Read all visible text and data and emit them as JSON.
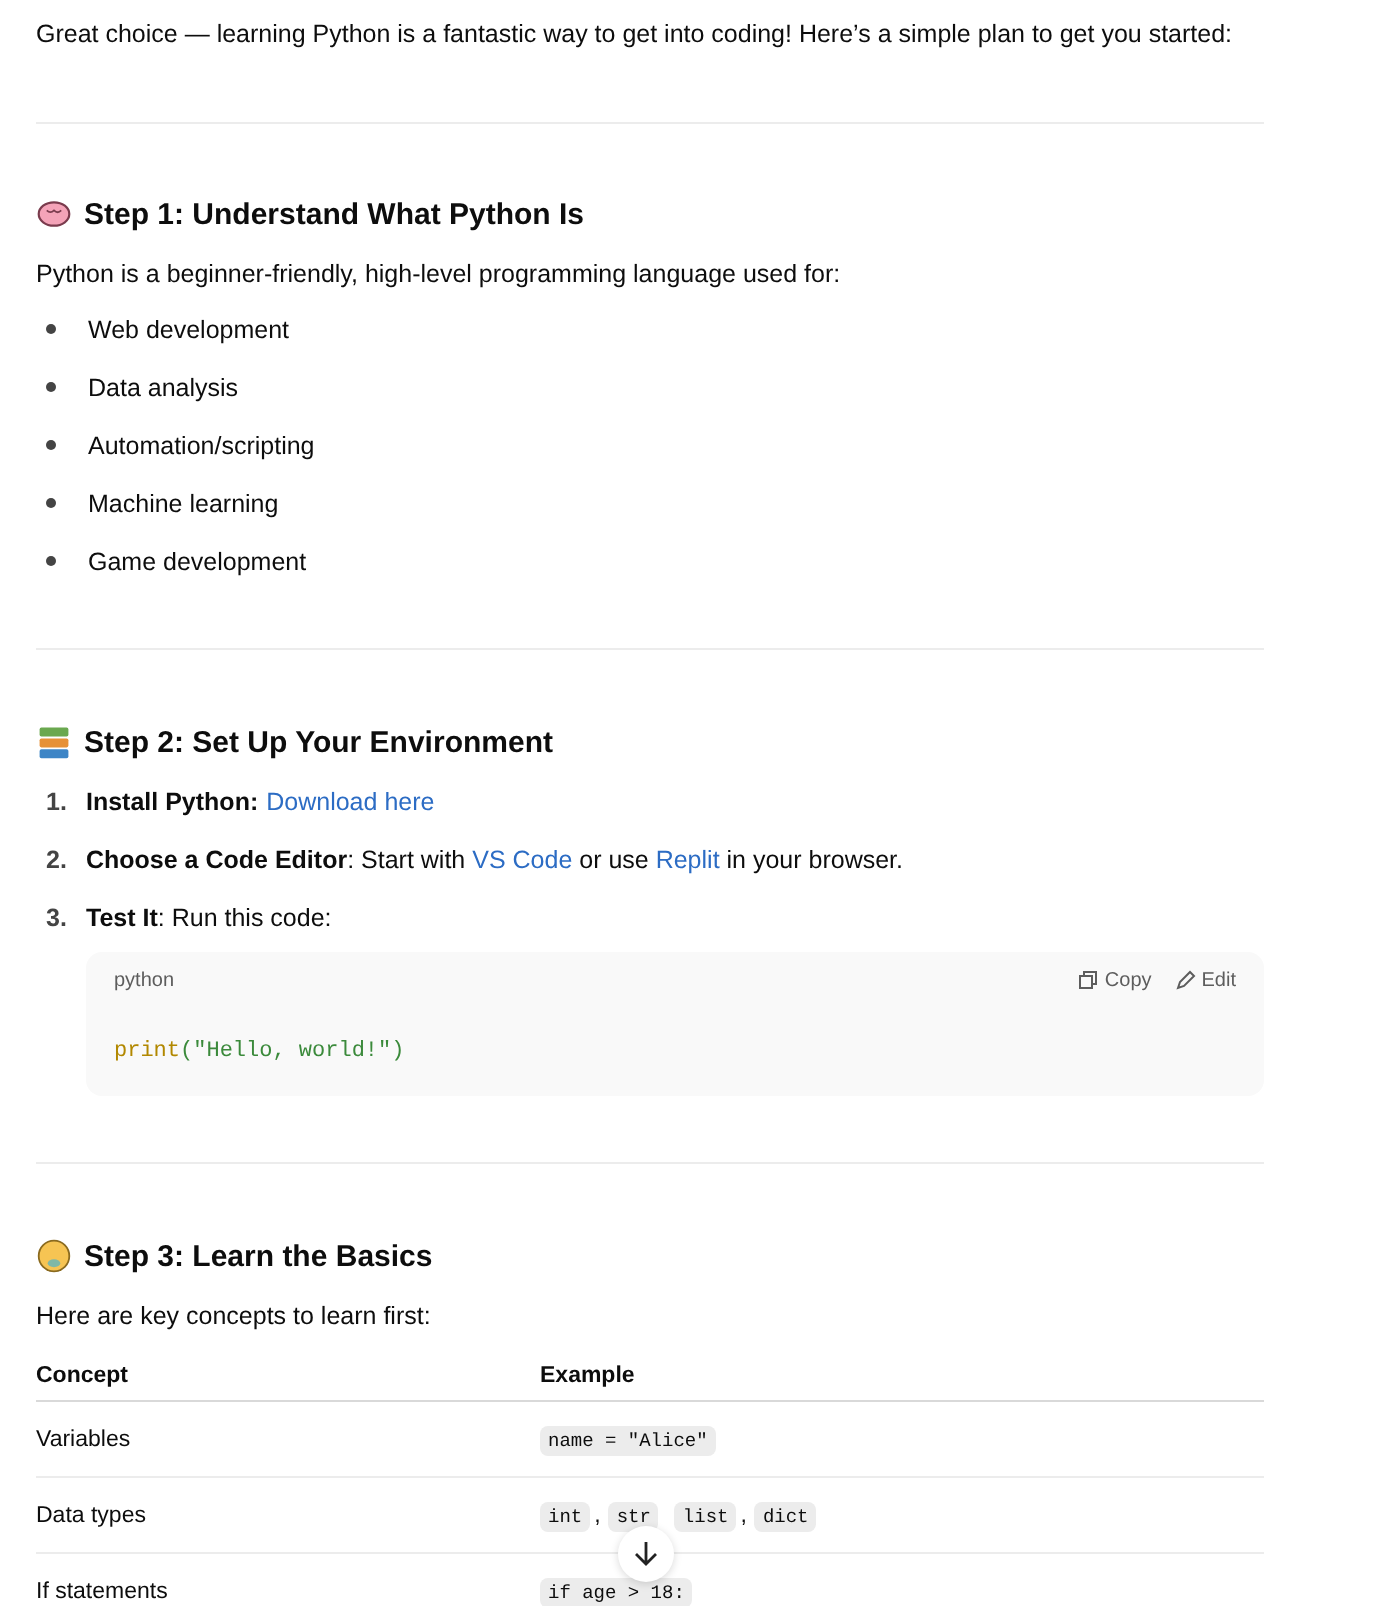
{
  "intro": "Great choice — learning Python is a fantastic way to get into coding! Here’s a simple plan to get you started:",
  "sections": [
    {
      "title": "Step 1: Understand What Python Is",
      "paragraph": "Python is a beginner-friendly, high-level programming language used for:",
      "bullets": [
        "Web development",
        "Data analysis",
        "Automation/scripting",
        "Machine learning",
        "Game development"
      ]
    },
    {
      "title": "Step 2: Set Up Your Environment",
      "steps": [
        {
          "number": "1.",
          "parts": [
            {
              "kind": "bold",
              "text": "Install Python:"
            },
            {
              "kind": "link",
              "text": "Download here"
            }
          ]
        },
        {
          "number": "2.",
          "parts": [
            {
              "kind": "bold",
              "text": "Choose a Code Editor"
            },
            {
              "kind": "plain",
              "text": ": Start with "
            },
            {
              "kind": "link",
              "text": "VS Code"
            },
            {
              "kind": "plain",
              "text": " or use "
            },
            {
              "kind": "link",
              "text": "Replit"
            },
            {
              "kind": "plain",
              "text": " in your browser."
            }
          ]
        },
        {
          "number": "3.",
          "parts": [
            {
              "kind": "bold",
              "text": "Test It"
            },
            {
              "kind": "plain",
              "text": ": Run this code:"
            }
          ],
          "code": {
            "language": "python",
            "copy": "Copy",
            "edit": "Edit",
            "func": "print",
            "args": "(\"Hello, world!\")"
          }
        }
      ]
    },
    {
      "title": "Step 3: Learn the Basics",
      "paragraph": "Here are key concepts to learn first:",
      "table": {
        "columns": [
          "Concept",
          "Example"
        ],
        "rows": [
          {
            "concept": "Variables",
            "example": [
              {
                "code": "name = \"Alice\""
              }
            ]
          },
          {
            "concept": "Data types",
            "example": [
              {
                "code": "int",
                "trailing": ","
              },
              {
                "code": "str"
              },
              {
                "code": "list",
                "trailing": ","
              },
              {
                "code": "dict"
              }
            ]
          },
          {
            "concept": "If statements",
            "example": [
              {
                "code": "if age > 18:"
              }
            ]
          }
        ]
      }
    }
  ]
}
